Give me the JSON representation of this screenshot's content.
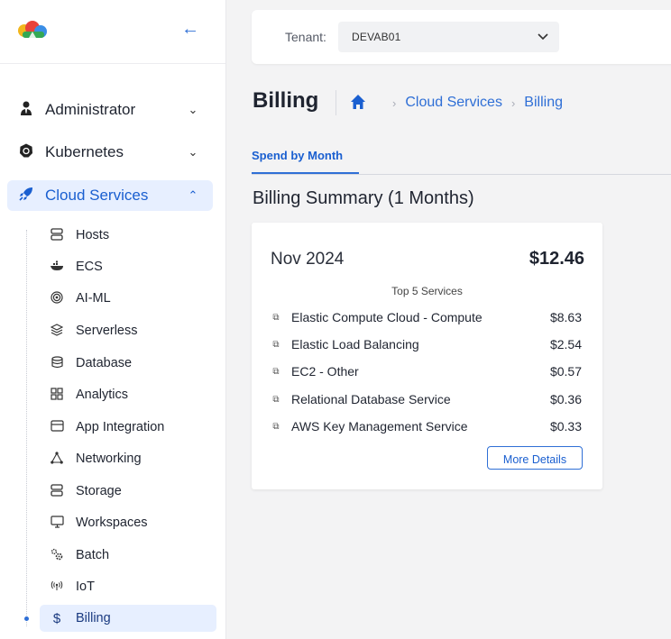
{
  "sidebar": {
    "nav": [
      {
        "label": "Administrator",
        "icon": "user-tie-icon",
        "chevron": "⌄"
      },
      {
        "label": "Kubernetes",
        "icon": "kubernetes-icon",
        "chevron": "⌄"
      },
      {
        "label": "Cloud Services",
        "icon": "rocket-icon",
        "chevron": "⌃"
      }
    ],
    "sub_items": [
      {
        "label": "Hosts",
        "icon": "server-icon"
      },
      {
        "label": "ECS",
        "icon": "docker-icon"
      },
      {
        "label": "AI-ML",
        "icon": "ai-target-icon"
      },
      {
        "label": "Serverless",
        "icon": "layers-icon"
      },
      {
        "label": "Database",
        "icon": "database-icon"
      },
      {
        "label": "Analytics",
        "icon": "grid-icon"
      },
      {
        "label": "App Integration",
        "icon": "app-integration-icon"
      },
      {
        "label": "Networking",
        "icon": "network-icon"
      },
      {
        "label": "Storage",
        "icon": "storage-icon"
      },
      {
        "label": "Workspaces",
        "icon": "monitor-icon"
      },
      {
        "label": "Batch",
        "icon": "gears-icon"
      },
      {
        "label": "IoT",
        "icon": "iot-antenna-icon"
      },
      {
        "label": "Billing",
        "icon": "dollar-icon"
      }
    ]
  },
  "topbar": {
    "tenant_label": "Tenant:",
    "tenant_value": "DEVAB01"
  },
  "header": {
    "title": "Billing",
    "breadcrumbs": [
      "Cloud Services",
      "Billing"
    ]
  },
  "tabs": [
    "Spend by Month"
  ],
  "summary_title": "Billing Summary (1 Months)",
  "card": {
    "month": "Nov 2024",
    "total": "$12.46",
    "top_label": "Top 5 Services",
    "services": [
      {
        "name": "Elastic Compute Cloud - Compute",
        "cost": "$8.63"
      },
      {
        "name": "Elastic Load Balancing",
        "cost": "$2.54"
      },
      {
        "name": "EC2 - Other",
        "cost": "$0.57"
      },
      {
        "name": "Relational Database Service",
        "cost": "$0.36"
      },
      {
        "name": "AWS Key Management Service",
        "cost": "$0.33"
      }
    ],
    "more_label": "More Details"
  },
  "colors": {
    "accent": "#2f6fd6",
    "active_bg": "#e7efff",
    "page_bg": "#f3f3f4"
  }
}
